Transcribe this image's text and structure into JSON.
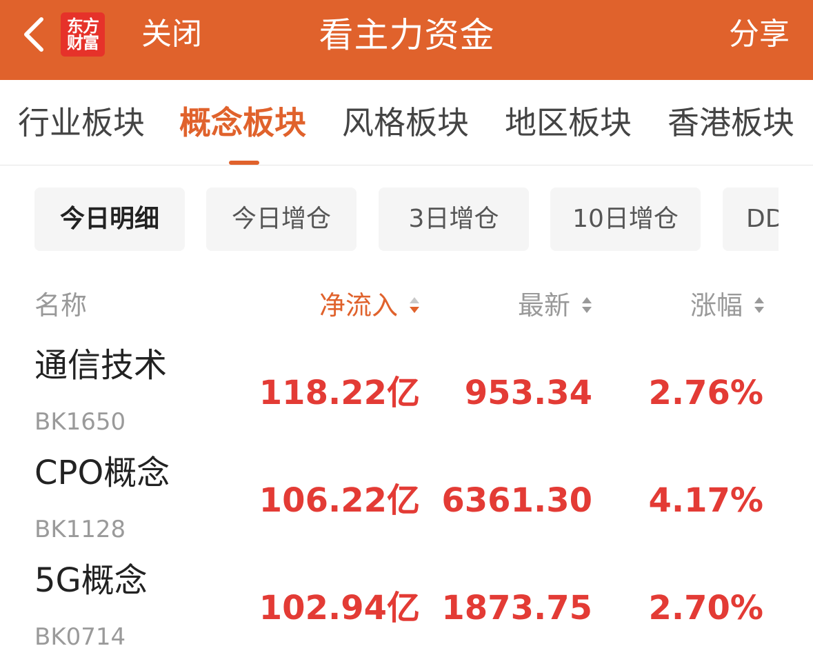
{
  "header": {
    "logo_line1": "东方",
    "logo_line2": "财富",
    "close_label": "关闭",
    "title": "看主力资金",
    "share_label": "分享"
  },
  "tabs": [
    {
      "label": "行业板块",
      "active": false
    },
    {
      "label": "概念板块",
      "active": true
    },
    {
      "label": "风格板块",
      "active": false
    },
    {
      "label": "地区板块",
      "active": false
    },
    {
      "label": "香港板块",
      "active": false
    }
  ],
  "filters": [
    {
      "label": "今日明细",
      "active": true
    },
    {
      "label": "今日增仓",
      "active": false
    },
    {
      "label": "3日增仓",
      "active": false
    },
    {
      "label": "10日增仓",
      "active": false
    },
    {
      "label": "DD",
      "active": false
    }
  ],
  "table": {
    "columns": {
      "name": "名称",
      "net_inflow": "净流入",
      "latest": "最新",
      "change": "涨幅"
    },
    "sorted_by": "net_inflow",
    "sort_direction": "desc",
    "rows": [
      {
        "name": "通信技术",
        "code": "BK1650",
        "net_inflow": "118.22亿",
        "latest": "953.34",
        "change": "2.76%"
      },
      {
        "name": "CPO概念",
        "code": "BK1128",
        "net_inflow": "106.22亿",
        "latest": "6361.30",
        "change": "4.17%"
      },
      {
        "name": "5G概念",
        "code": "BK0714",
        "net_inflow": "102.94亿",
        "latest": "1873.75",
        "change": "2.70%"
      }
    ]
  },
  "colors": {
    "brand": "#e0622c",
    "logo_red": "#e6322a",
    "rise_red": "#e33b35",
    "muted_text": "#999999",
    "chip_bg": "#f5f5f5"
  }
}
